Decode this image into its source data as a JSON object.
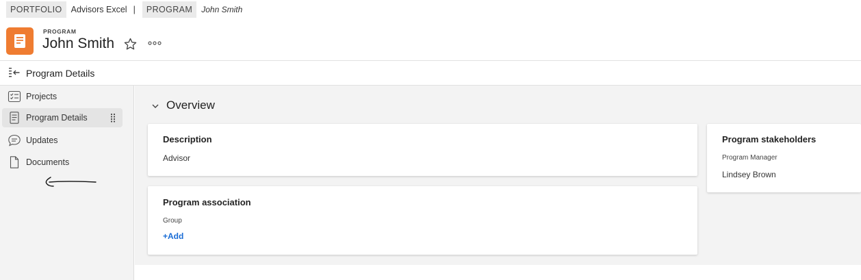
{
  "breadcrumb": {
    "portfolio_chip": "PORTFOLIO",
    "portfolio_name": "Advisors Excel",
    "separator": "|",
    "program_chip": "PROGRAM",
    "program_name": "John Smith"
  },
  "header": {
    "eyebrow": "PROGRAM",
    "title": "John Smith",
    "icon": "program-document-icon",
    "accent_color": "#ef7c31"
  },
  "section_bar": {
    "title": "Program Details"
  },
  "sidebar": {
    "items": [
      {
        "label": "Projects",
        "icon": "projects-icon",
        "active": false
      },
      {
        "label": "Program Details",
        "icon": "document-lines-icon",
        "active": true
      },
      {
        "label": "Updates",
        "icon": "chat-bubble-icon",
        "active": false
      },
      {
        "label": "Documents",
        "icon": "file-icon",
        "active": false
      }
    ]
  },
  "main": {
    "overview_title": "Overview",
    "description_card": {
      "title": "Description",
      "value": "Advisor"
    },
    "association_card": {
      "title": "Program association",
      "field_label": "Group",
      "add_link": "+Add"
    },
    "stakeholders_card": {
      "title": "Program stakeholders",
      "role_label": "Program Manager",
      "person": "Lindsey Brown"
    }
  },
  "colors": {
    "link": "#1a6dd6",
    "accent": "#ef7c31",
    "sidebar_bg": "#f3f3f3"
  }
}
